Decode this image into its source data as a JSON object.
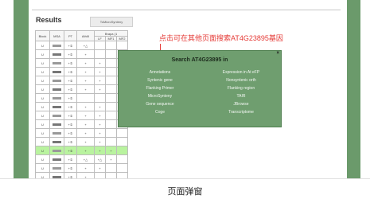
{
  "page": {
    "results_title": "Results",
    "tomicrosynteny_label": "ToMicroSynteny",
    "annotation_text": "点击可在其他页面搜索AT4G23895基因",
    "caption": "页面弹窗"
  },
  "table": {
    "headers": [
      "Block",
      "MSA",
      "PT",
      "AthIII"
    ],
    "group_header": "Brapa (1",
    "sub_headers": [
      "LF",
      "MF1",
      "MF2"
    ],
    "rows": [
      {
        "block": "U",
        "pt": "+①",
        "ath": "+△",
        "lf": "",
        "mf1": "",
        "mf2": ""
      },
      {
        "block": "U",
        "pt": "+①",
        "ath": "+",
        "lf": "",
        "mf1": "",
        "mf2": ""
      },
      {
        "block": "U",
        "pt": "+①",
        "ath": "+",
        "lf": "+",
        "mf1": "",
        "mf2": ""
      },
      {
        "block": "U",
        "pt": "+①",
        "ath": "+",
        "lf": "+",
        "mf1": "",
        "mf2": ""
      },
      {
        "block": "U",
        "pt": "+①",
        "ath": "+",
        "lf": "+",
        "mf1": "",
        "mf2": ""
      },
      {
        "block": "U",
        "pt": "+①",
        "ath": "+",
        "lf": "+",
        "mf1": "",
        "mf2": ""
      },
      {
        "block": "U",
        "pt": "+①",
        "ath": "",
        "lf": "",
        "mf1": "",
        "mf2": ""
      },
      {
        "block": "U",
        "pt": "+①",
        "ath": "+",
        "lf": "+",
        "mf1": "",
        "mf2": ""
      },
      {
        "block": "U",
        "pt": "+①",
        "ath": "+",
        "lf": "+",
        "mf1": "",
        "mf2": ""
      },
      {
        "block": "U",
        "pt": "+①",
        "ath": "+",
        "lf": "+",
        "mf1": "",
        "mf2": ""
      },
      {
        "block": "U",
        "pt": "+①",
        "ath": "+",
        "lf": "+",
        "mf1": "",
        "mf2": ""
      },
      {
        "block": "U",
        "pt": "+①",
        "ath": "+",
        "lf": "+",
        "mf1": "",
        "mf2": ""
      },
      {
        "block": "U",
        "pt": "+①",
        "ath": "+",
        "lf": "+",
        "mf1": "+",
        "mf2": ""
      },
      {
        "block": "U",
        "pt": "+①",
        "ath": "+△",
        "lf": "+△",
        "mf1": "+",
        "mf2": ""
      },
      {
        "block": "U",
        "pt": "+①",
        "ath": "+",
        "lf": "+",
        "mf1": "",
        "mf2": ""
      },
      {
        "block": "U",
        "pt": "+①",
        "ath": "+",
        "lf": "",
        "mf1": "",
        "mf2": ""
      },
      {
        "block": "U",
        "pt": "+①",
        "ath": "+",
        "lf": "",
        "mf1": "",
        "mf2": ""
      },
      {
        "block": "U",
        "pt": "+①",
        "ath": "+",
        "lf": "",
        "mf1": "",
        "mf2": ""
      }
    ],
    "highlight_row_index": 12
  },
  "popup": {
    "title": "Search AT4G23895 in",
    "close_label": "×",
    "links_left": [
      "Annotations",
      "Syntenic gene",
      "Flanking Primer",
      "MicroSynteny",
      "Gene sequence",
      "Coge"
    ],
    "links_right": [
      "Expression in At eFP",
      "Nonsyntenic orth",
      "Flanking region",
      "TAIR",
      "JBrowse",
      "Transcriptome"
    ]
  },
  "colors": {
    "rail": "#6b9a6b",
    "popup_bg": "#6f9e6f",
    "highlight_row": "#b9f39f",
    "annotation": "#e53935"
  }
}
